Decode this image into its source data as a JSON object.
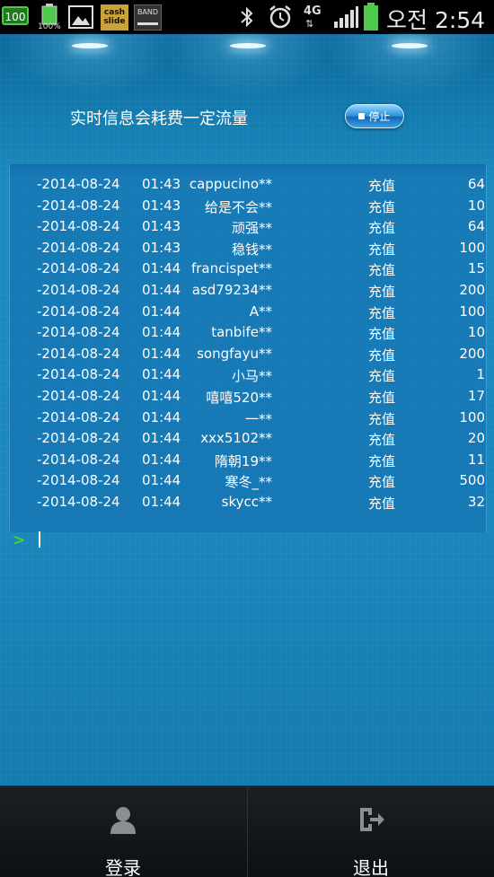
{
  "status_bar": {
    "battery_text": "100",
    "battery_percent": "100%",
    "cashslide_label": "cash slide",
    "band_label": "BAND",
    "network": "4G",
    "network_arrows": "⇅",
    "time": "오전 2:54"
  },
  "header": {
    "info_text": "实时信息会耗费一定流量",
    "stop_label": "停止"
  },
  "log": {
    "rows": [
      {
        "date": "-2014-08-24",
        "time": "01:43",
        "user": "cappucino**",
        "type": "充值",
        "amount": "64"
      },
      {
        "date": "-2014-08-24",
        "time": "01:43",
        "user": "给是不会**",
        "type": "充值",
        "amount": "10"
      },
      {
        "date": "-2014-08-24",
        "time": "01:43",
        "user": "顽强**",
        "type": "充值",
        "amount": "64"
      },
      {
        "date": "-2014-08-24",
        "time": "01:43",
        "user": "稳钱**",
        "type": "充值",
        "amount": "100"
      },
      {
        "date": "-2014-08-24",
        "time": "01:44",
        "user": "francispet**",
        "type": "充值",
        "amount": "15"
      },
      {
        "date": "-2014-08-24",
        "time": "01:44",
        "user": "asd79234**",
        "type": "充值",
        "amount": "200"
      },
      {
        "date": "-2014-08-24",
        "time": "01:44",
        "user": "A**",
        "type": "充值",
        "amount": "100"
      },
      {
        "date": "-2014-08-24",
        "time": "01:44",
        "user": "tanbife**",
        "type": "充值",
        "amount": "10"
      },
      {
        "date": "-2014-08-24",
        "time": "01:44",
        "user": "songfayu**",
        "type": "充值",
        "amount": "200"
      },
      {
        "date": "-2014-08-24",
        "time": "01:44",
        "user": "小马**",
        "type": "充值",
        "amount": "1"
      },
      {
        "date": "-2014-08-24",
        "time": "01:44",
        "user": "嘻嘻520**",
        "type": "充值",
        "amount": "17"
      },
      {
        "date": "-2014-08-24",
        "time": "01:44",
        "user": "一**",
        "type": "充值",
        "amount": "100"
      },
      {
        "date": "-2014-08-24",
        "time": "01:44",
        "user": "xxx5102**",
        "type": "充值",
        "amount": "20"
      },
      {
        "date": "-2014-08-24",
        "time": "01:44",
        "user": "隋朝19**",
        "type": "充值",
        "amount": "11"
      },
      {
        "date": "-2014-08-24",
        "time": "01:44",
        "user": "寒冬_**",
        "type": "充值",
        "amount": "500"
      },
      {
        "date": "-2014-08-24",
        "time": "01:44",
        "user": "skycc**",
        "type": "充值",
        "amount": "32"
      }
    ]
  },
  "console": {
    "prompt": ">"
  },
  "bottom_nav": {
    "login_label": "登录",
    "logout_label": "退出"
  },
  "icons": {
    "login": "person-icon",
    "logout": "exit-icon"
  },
  "colors": {
    "accent": "#1a88be",
    "prompt": "#3fd63f",
    "nav_bg": "#0d1012"
  }
}
